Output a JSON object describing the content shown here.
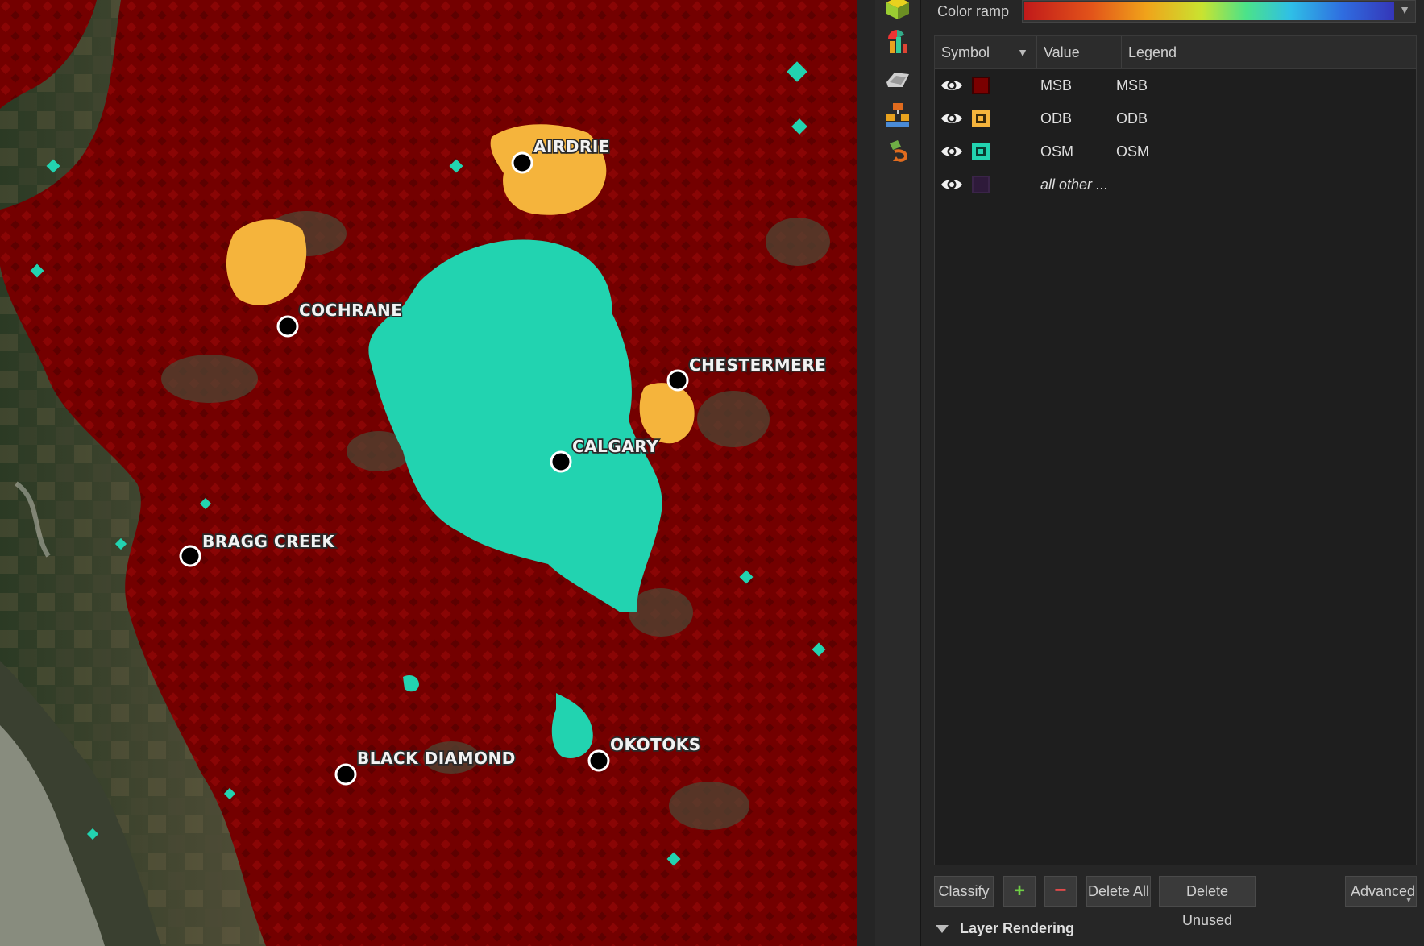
{
  "map": {
    "cities": [
      {
        "name": "AIRDRIE"
      },
      {
        "name": "COCHRANE"
      },
      {
        "name": "CHESTERMERE"
      },
      {
        "name": "CALGARY"
      },
      {
        "name": "BRAGG CREEK"
      },
      {
        "name": "BLACK DIAMOND"
      },
      {
        "name": "OKOTOKS"
      }
    ],
    "colors": {
      "msb": "#7a0000",
      "odb": "#f5b43c",
      "osm": "#22d3b0"
    }
  },
  "toolbar": {
    "icons": [
      "3d-view-icon",
      "diagrams-icon",
      "fields-icon",
      "rendering-icon",
      "actions-icon"
    ]
  },
  "panel": {
    "color_ramp_label": "Color ramp",
    "table": {
      "headers": {
        "symbol": "Symbol",
        "value": "Value",
        "legend": "Legend"
      },
      "rows": [
        {
          "value": "MSB",
          "legend": "MSB",
          "color": "#7a0000"
        },
        {
          "value": "ODB",
          "legend": "ODB",
          "color": "#f5b43c"
        },
        {
          "value": "OSM",
          "legend": "OSM",
          "color": "#22d3b0"
        },
        {
          "value": "all other ...",
          "legend": "",
          "color": "#3a1a4a"
        }
      ]
    },
    "buttons": {
      "classify": "Classify",
      "add": "+",
      "remove": "−",
      "delete_all": "Delete All",
      "delete_unused": "Delete Unused",
      "advanced": "Advanced"
    },
    "layer_rendering": "Layer Rendering"
  }
}
